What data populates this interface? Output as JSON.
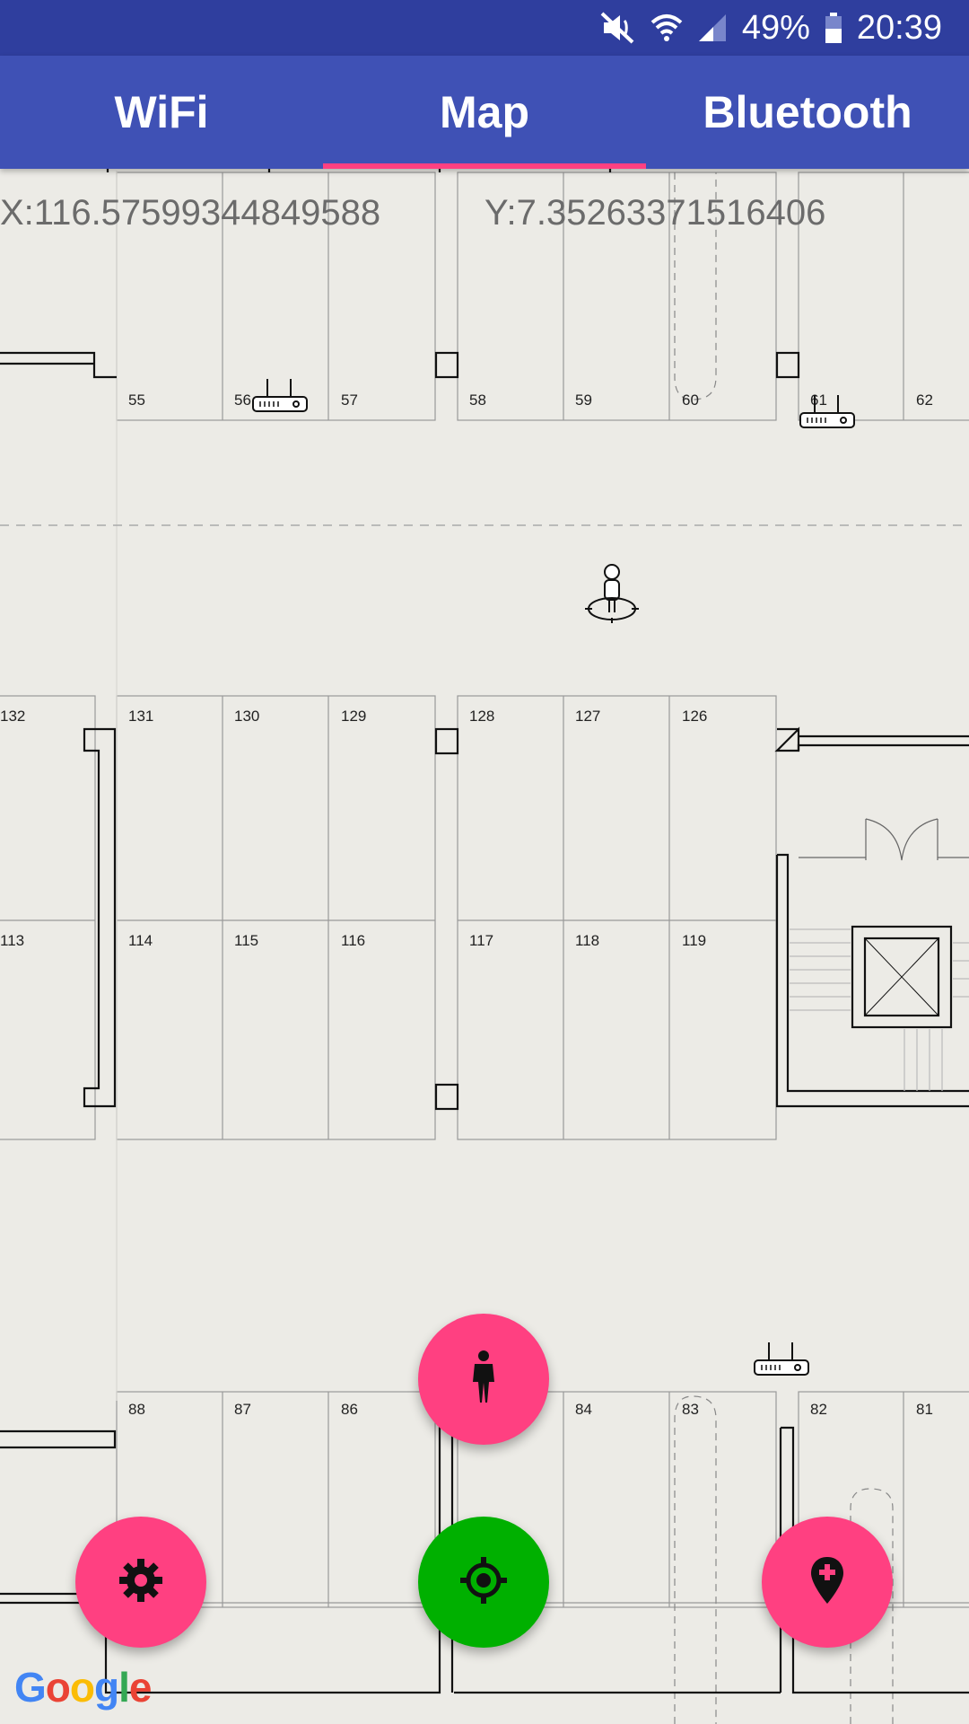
{
  "status_bar": {
    "battery": "49%",
    "time": "20:39",
    "icons": [
      "mute-icon",
      "wifi-icon",
      "signal-icon",
      "battery-icon"
    ]
  },
  "tabs": [
    {
      "label": "WiFi",
      "active": false
    },
    {
      "label": "Map",
      "active": true
    },
    {
      "label": "Bluetooth",
      "active": false
    }
  ],
  "coordinates": {
    "x_text": "X:116.57599344849588",
    "y_text": "Y:7.35263371516406"
  },
  "map": {
    "room_labels": [
      "55",
      "56",
      "57",
      "58",
      "59",
      "60",
      "61",
      "62",
      "132",
      "131",
      "130",
      "129",
      "128",
      "127",
      "126",
      "113",
      "114",
      "115",
      "116",
      "117",
      "118",
      "119",
      "88",
      "87",
      "86",
      "84",
      "83",
      "82",
      "81"
    ]
  },
  "fabs": {
    "walk": "walk-icon",
    "settings": "gear-icon",
    "locate": "locate-icon",
    "add_marker": "add-location-icon"
  },
  "colors": {
    "status_bar": "#2f3e9e",
    "toolbar": "#3f51b5",
    "accent": "#ff4081",
    "locate_button": "#00b000",
    "map_background": "#ecebe6"
  },
  "logo": {
    "letters": [
      "G",
      "o",
      "o",
      "g",
      "l",
      "e"
    ],
    "colors": [
      "#4285f4",
      "#ea4335",
      "#fbbc05",
      "#4285f4",
      "#34a853",
      "#ea4335"
    ]
  }
}
